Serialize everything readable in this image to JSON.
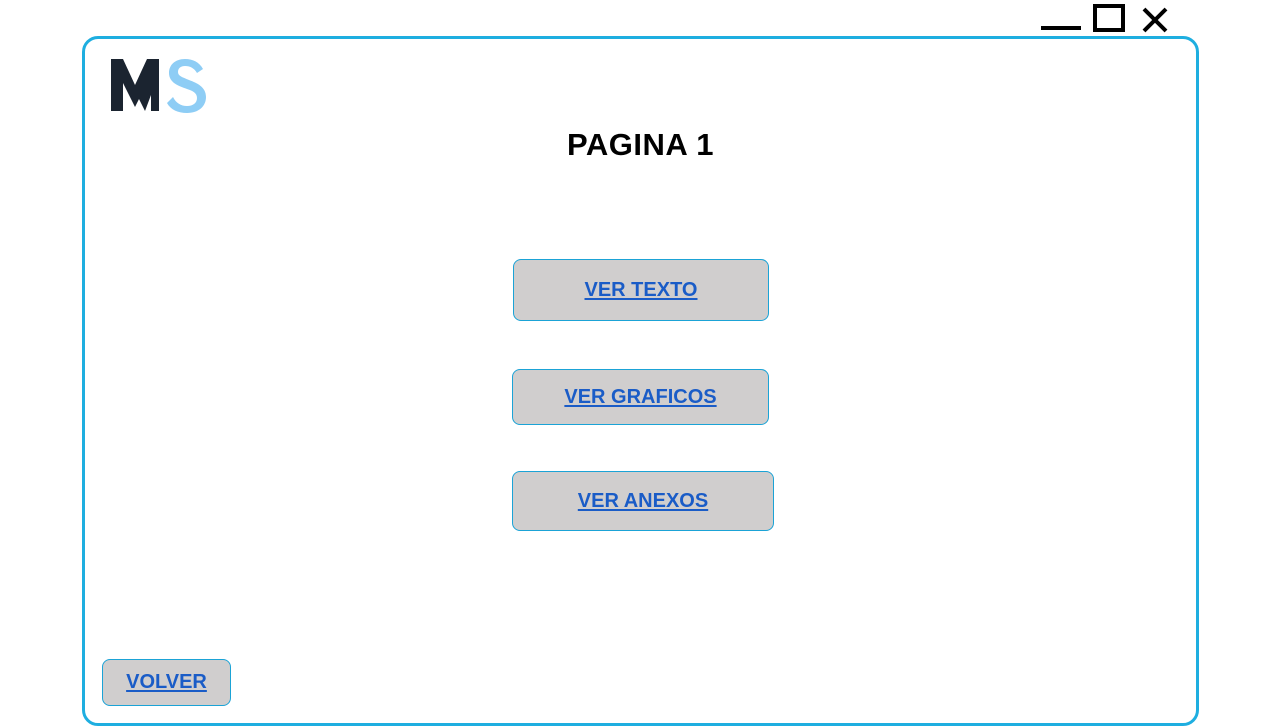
{
  "window_controls": {
    "minimize": "minimize-icon",
    "maximize": "maximize-icon",
    "close": "close-icon"
  },
  "logo": {
    "text": "MS",
    "colors": {
      "m": "#1b2430",
      "s": "#8ecdf5"
    }
  },
  "page": {
    "title": "PAGINA 1"
  },
  "buttons": {
    "ver_texto": "VER TEXTO",
    "ver_graficos": "VER GRAFICOS",
    "ver_anexos": "VER ANEXOS",
    "volver": "VOLVER"
  },
  "colors": {
    "frame_border": "#1eaee0",
    "button_fill": "#d0cece",
    "button_border": "#1ba3d6",
    "link_text": "#1a5cc7"
  }
}
